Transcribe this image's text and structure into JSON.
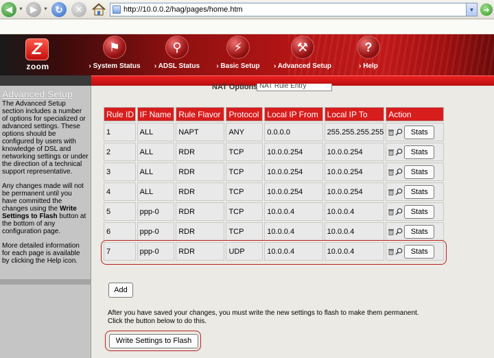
{
  "browser": {
    "url": "http://10.0.0.2/hag/pages/home.htm"
  },
  "header": {
    "logo_text": "zoom",
    "nav": [
      {
        "label": "System Status",
        "icon": "system-status-icon"
      },
      {
        "label": "ADSL Status",
        "icon": "magnifier-icon"
      },
      {
        "label": "Basic Setup",
        "icon": "plug-icon"
      },
      {
        "label": "Advanced Setup",
        "icon": "wrench-icon"
      },
      {
        "label": "Help",
        "icon": "question-icon"
      }
    ],
    "accent_color": "#c01818"
  },
  "sidebar": {
    "title": "Advanced Setup",
    "para1": "The Advanced Setup section includes a number of options for specialized or advanced settings. These options should be configured by users with knowledge of DSL and networking settings or under the direction of a technical support representative.",
    "para2_pre": "Any changes made will not be permanent until you have committed the changes using the ",
    "para2_bold": "Write Settings to Flash",
    "para2_post": " button at the bottom of any configuration page.",
    "para3": "More detailed information for each page is available by clicking the Help icon."
  },
  "main": {
    "nat_label": "NAT Options:",
    "nat_select_value": "NAT Rule Entry",
    "table": {
      "headers": [
        "Rule ID",
        "IF Name",
        "Rule Flavor",
        "Protocol",
        "Local IP From",
        "Local IP To",
        "Action"
      ],
      "rows": [
        {
          "id": "1",
          "if_name": "ALL",
          "flavor": "NAPT",
          "protocol": "ANY",
          "ip_from": "0.0.0.0",
          "ip_to": "255.255.255.255"
        },
        {
          "id": "2",
          "if_name": "ALL",
          "flavor": "RDR",
          "protocol": "TCP",
          "ip_from": "10.0.0.254",
          "ip_to": "10.0.0.254"
        },
        {
          "id": "3",
          "if_name": "ALL",
          "flavor": "RDR",
          "protocol": "TCP",
          "ip_from": "10.0.0.254",
          "ip_to": "10.0.0.254"
        },
        {
          "id": "4",
          "if_name": "ALL",
          "flavor": "RDR",
          "protocol": "TCP",
          "ip_from": "10.0.0.254",
          "ip_to": "10.0.0.254"
        },
        {
          "id": "5",
          "if_name": "ppp-0",
          "flavor": "RDR",
          "protocol": "TCP",
          "ip_from": "10.0.0.4",
          "ip_to": "10.0.0.4"
        },
        {
          "id": "6",
          "if_name": "ppp-0",
          "flavor": "RDR",
          "protocol": "TCP",
          "ip_from": "10.0.0.4",
          "ip_to": "10.0.0.4"
        },
        {
          "id": "7",
          "if_name": "ppp-0",
          "flavor": "RDR",
          "protocol": "UDP",
          "ip_from": "10.0.0.4",
          "ip_to": "10.0.0.4"
        }
      ],
      "stats_label": "Stats"
    },
    "add_label": "Add",
    "info_line1": "After you have saved your changes, you must write the new settings to flash to make them permanent.",
    "info_line2": "Click the button below to do this.",
    "write_label": "Write Settings to Flash"
  }
}
